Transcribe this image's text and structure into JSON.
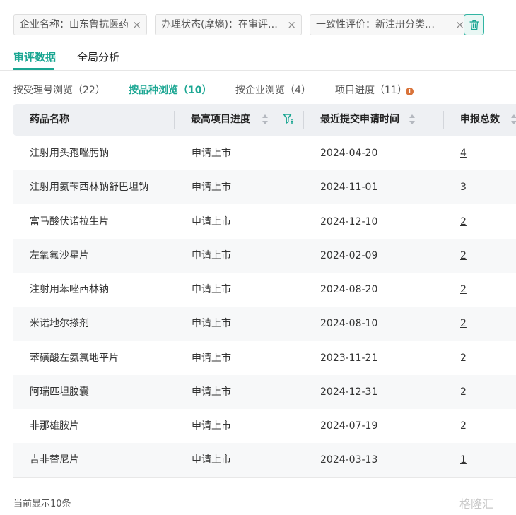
{
  "filters": {
    "chips": [
      {
        "label": "企业名称：山东鲁抗医药"
      },
      {
        "label": "办理状态(摩熵)：在审评…"
      },
      {
        "label": "一致性评价：新注册分类…"
      }
    ],
    "close_glyph": "×"
  },
  "main_tabs": [
    {
      "label": "审评数据",
      "active": true
    },
    {
      "label": "全局分析",
      "active": false
    }
  ],
  "sub_tabs": [
    {
      "label": "按受理号浏览（22）",
      "active": false
    },
    {
      "label": "按品种浏览（10）",
      "active": true
    },
    {
      "label": "按企业浏览（4）",
      "active": false
    },
    {
      "label": "项目进度（11）",
      "active": false
    }
  ],
  "info_icon": "i",
  "table": {
    "headers": [
      "药品名称",
      "最高项目进度",
      "最近提交申请时间",
      "申报总数"
    ],
    "rows": [
      {
        "name": "注射用头孢唑肟钠",
        "progress": "申请上市",
        "date": "2024-04-20",
        "count": "4"
      },
      {
        "name": "注射用氨苄西林钠舒巴坦钠",
        "progress": "申请上市",
        "date": "2024-11-01",
        "count": "3"
      },
      {
        "name": "富马酸伏诺拉生片",
        "progress": "申请上市",
        "date": "2024-12-10",
        "count": "2"
      },
      {
        "name": "左氧氟沙星片",
        "progress": "申请上市",
        "date": "2024-02-09",
        "count": "2"
      },
      {
        "name": "注射用苯唑西林钠",
        "progress": "申请上市",
        "date": "2024-08-20",
        "count": "2"
      },
      {
        "name": "米诺地尔搽剂",
        "progress": "申请上市",
        "date": "2024-08-10",
        "count": "2"
      },
      {
        "name": "苯磺酸左氨氯地平片",
        "progress": "申请上市",
        "date": "2023-11-21",
        "count": "2"
      },
      {
        "name": "阿瑞匹坦胶囊",
        "progress": "申请上市",
        "date": "2024-12-31",
        "count": "2"
      },
      {
        "name": "非那雄胺片",
        "progress": "申请上市",
        "date": "2024-07-19",
        "count": "2"
      },
      {
        "name": "吉非替尼片",
        "progress": "申请上市",
        "date": "2024-03-13",
        "count": "1"
      }
    ]
  },
  "footer": {
    "text": "当前显示10条"
  },
  "watermark": "格隆汇",
  "colors": {
    "accent": "#1aa692",
    "header_bg": "#eef0f3",
    "info_dot": "#d9733a"
  }
}
